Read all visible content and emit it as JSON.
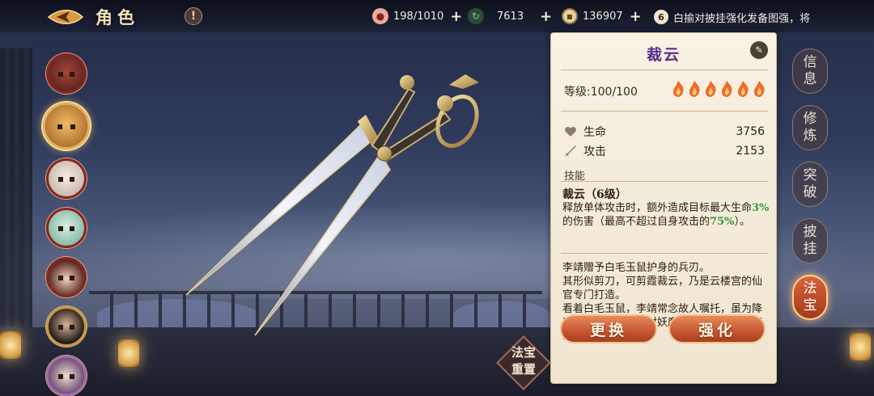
{
  "header": {
    "title": "角色",
    "alert_glyph": "!",
    "resources": [
      {
        "name": "peach",
        "value": "198/1010",
        "icon": "peach-icon",
        "color": "#f2a6a0"
      },
      {
        "name": "refresh",
        "value": "7613",
        "icon": "cycle-icon",
        "color": "#6fcf8a"
      },
      {
        "name": "coins",
        "value": "136907",
        "icon": "coin-icon",
        "color": "#e8d39a"
      }
    ],
    "plus_glyph": "+",
    "notice_number": "6",
    "notice_text": "白揄对披挂强化发备图强，将"
  },
  "characters": [
    {
      "name": "demon-king",
      "color": "#6b2a22"
    },
    {
      "name": "lion-warrior",
      "color": "#c0832e",
      "active": true
    },
    {
      "name": "white-haired-elder",
      "color": "#d9ccc0"
    },
    {
      "name": "green-spirit",
      "color": "#8bbfa6"
    },
    {
      "name": "crowned-maiden",
      "color": "#6a2d25"
    },
    {
      "name": "bearded-general",
      "color": "#2f2a24"
    },
    {
      "name": "young-scholar",
      "color": "#c6a5c6"
    }
  ],
  "panel": {
    "title": "裁云",
    "level_text": "等级:100/100",
    "flame_count": 6,
    "stats": [
      {
        "label": "生命",
        "value": "3756",
        "icon": "heart-icon"
      },
      {
        "label": "攻击",
        "value": "2153",
        "icon": "sword-icon"
      }
    ],
    "skill_section_label": "技能",
    "skill_name": "裁云（6级）",
    "skill_desc_1": "释放单体攻击时，额外造成目标最大生命",
    "skill_desc_pct1": "3%",
    "skill_desc_2": "的伤害（最高不超过自身攻击的",
    "skill_desc_pct2": "75%",
    "skill_desc_3": "）。",
    "lore": "李靖赠予白毛玉鼠护身的兵刃。\n其形似剪刀，可剪霞裁云，乃是云楼宫的仙官专门打造。\n看着白毛玉鼠，李靖常念故人嘱托，虽为降魔大元帅，但是面对妖魔之时，拔剑的速度却也慢了许多。",
    "replace_label": "更换",
    "enhance_label": "强化"
  },
  "tabs": [
    {
      "label": "信息"
    },
    {
      "label": "修炼"
    },
    {
      "label": "突破"
    },
    {
      "label": "披挂"
    },
    {
      "label": "法宝",
      "active": true
    }
  ],
  "reset_label": "法宝重置"
}
